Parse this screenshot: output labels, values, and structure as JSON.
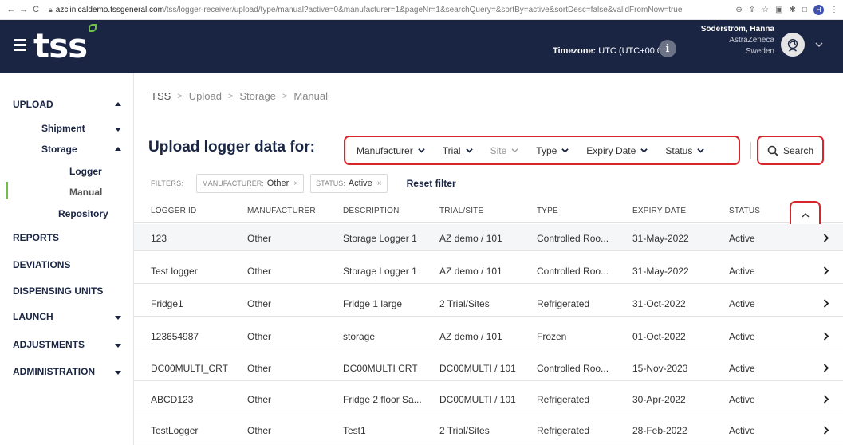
{
  "browser": {
    "url_domain": "azclinicaldemo.tssgeneral.com",
    "url_path": "/tss/logger-receiver/upload/type/manual?active=0&manufacturer=1&pageNr=1&searchQuery=&sortBy=active&sortDesc=false&validFromNow=true",
    "profile_initial": "H"
  },
  "header": {
    "logo_text": "tss",
    "timezone_label": "Timezone:",
    "timezone_value": "UTC (UTC+00:00)",
    "info_glyph": "i",
    "user_name": "Söderström, Hanna",
    "user_org": "AstraZeneca",
    "user_country": "Sweden"
  },
  "sidebar": {
    "upload": "UPLOAD",
    "shipment": "Shipment",
    "storage": "Storage",
    "logger": "Logger",
    "manual": "Manual",
    "repository": "Repository",
    "reports": "REPORTS",
    "deviations": "DEVIATIONS",
    "dispensing_units": "DISPENSING UNITS",
    "launch": "LAUNCH",
    "adjustments": "ADJUSTMENTS",
    "administration": "ADMINISTRATION"
  },
  "breadcrumb": [
    "TSS",
    "Upload",
    "Storage",
    "Manual"
  ],
  "breadcrumb_sep": ">",
  "page_title": "Upload logger data for:",
  "filters": {
    "manufacturer": "Manufacturer",
    "trial": "Trial",
    "site": "Site",
    "type": "Type",
    "expiry_date": "Expiry Date",
    "status": "Status"
  },
  "search_label": "Search",
  "active_filters": {
    "label": "FILTERS:",
    "chip1_key": "MANUFACTURER:",
    "chip1_value": "Other",
    "chip2_key": "STATUS:",
    "chip2_value": "Active",
    "chip_close": "×",
    "reset": "Reset filter"
  },
  "table": {
    "columns": [
      "LOGGER ID",
      "MANUFACTURER",
      "DESCRIPTION",
      "TRIAL/SITE",
      "TYPE",
      "EXPIRY DATE",
      "STATUS"
    ],
    "rows": [
      [
        "123",
        "Other",
        "Storage Logger 1",
        "AZ demo / 101",
        "Controlled Roo...",
        "31-May-2022",
        "Active"
      ],
      [
        "Test logger",
        "Other",
        "Storage Logger 1",
        "AZ demo / 101",
        "Controlled Roo...",
        "31-May-2022",
        "Active"
      ],
      [
        "Fridge1",
        "Other",
        "Fridge 1 large",
        "2 Trial/Sites",
        "Refrigerated",
        "31-Oct-2022",
        "Active"
      ],
      [
        "123654987",
        "Other",
        "storage",
        "AZ demo / 101",
        "Frozen",
        "01-Oct-2022",
        "Active"
      ],
      [
        "DC00MULTI_CRT",
        "Other",
        "DC00MULTI CRT",
        "DC00MULTI / 101",
        "Controlled Roo...",
        "15-Nov-2023",
        "Active"
      ],
      [
        "ABCD123",
        "Other",
        "Fridge 2 floor Sa...",
        "DC00MULTI / 101",
        "Refrigerated",
        "30-Apr-2022",
        "Active"
      ],
      [
        "TestLogger",
        "Other",
        "Test1",
        "2 Trial/Sites",
        "Refrigerated",
        "28-Feb-2022",
        "Active"
      ]
    ]
  },
  "colors": {
    "header_bg": "#1a2544",
    "accent_green": "#6fbf4a",
    "highlight_red": "#d6252b",
    "row_stripe": "#f5f6f8"
  }
}
